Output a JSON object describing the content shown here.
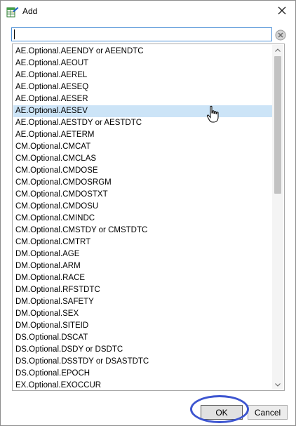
{
  "window": {
    "title": "Add"
  },
  "search": {
    "value": "",
    "placeholder": ""
  },
  "list": {
    "selected_index": 5,
    "items": [
      "AE.Optional.AEENDY or AEENDTC",
      "AE.Optional.AEOUT",
      "AE.Optional.AEREL",
      "AE.Optional.AESEQ",
      "AE.Optional.AESER",
      "AE.Optional.AESEV",
      "AE.Optional.AESTDY or AESTDTC",
      "AE.Optional.AETERM",
      "CM.Optional.CMCAT",
      "CM.Optional.CMCLAS",
      "CM.Optional.CMDOSE",
      "CM.Optional.CMDOSRGM",
      "CM.Optional.CMDOSTXT",
      "CM.Optional.CMDOSU",
      "CM.Optional.CMINDC",
      "CM.Optional.CMSTDY or CMSTDTC",
      "CM.Optional.CMTRT",
      "DM.Optional.AGE",
      "DM.Optional.ARM",
      "DM.Optional.RACE",
      "DM.Optional.RFSTDTC",
      "DM.Optional.SAFETY",
      "DM.Optional.SEX",
      "DM.Optional.SITEID",
      "DS.Optional.DSCAT",
      "DS.Optional.DSDY or DSDTC",
      "DS.Optional.DSSTDY or DSASTDTC",
      "DS.Optional.EPOCH",
      "EX.Optional.EXOCCUR"
    ]
  },
  "buttons": {
    "ok": "OK",
    "cancel": "Cancel"
  },
  "colors": {
    "selection": "#cce4f7",
    "focus_border": "#4c8fd6",
    "annotation_ring": "#3d55d0"
  }
}
